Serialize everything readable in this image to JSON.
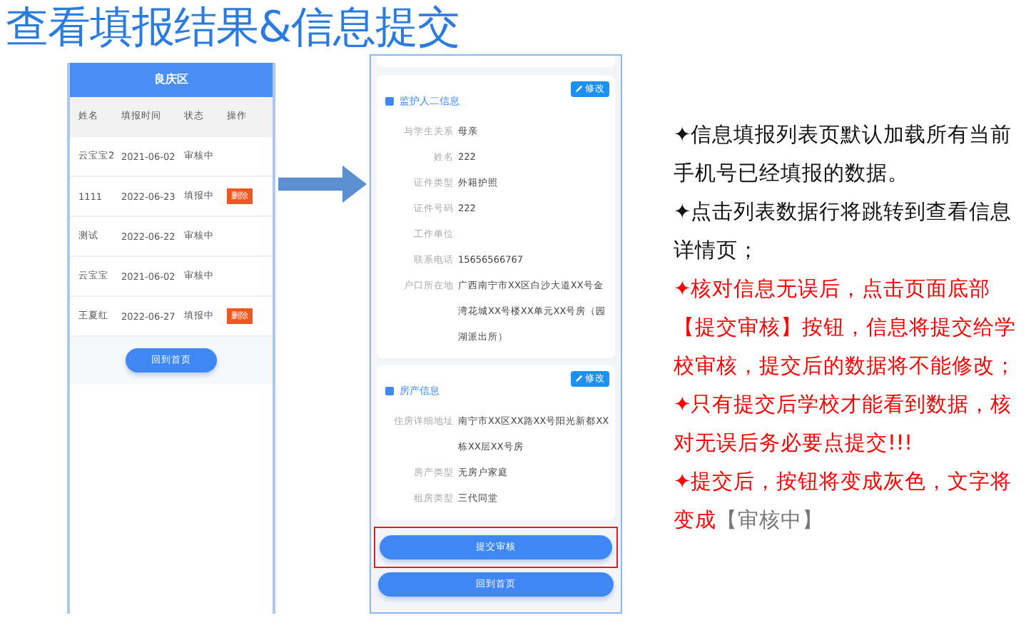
{
  "title": "查看填报结果&信息提交",
  "list_screen": {
    "header": "良庆区",
    "columns": [
      "姓名",
      "填报时间",
      "状态",
      "操作"
    ],
    "rows": [
      {
        "name": "云宝宝2",
        "date": "2021-06-02",
        "status": "审核中"
      },
      {
        "name": "1111",
        "date": "2022-06-23",
        "status": "填报中",
        "action": "删除"
      },
      {
        "name": "测试",
        "date": "2022-06-22",
        "status": "审核中"
      },
      {
        "name": "云宝宝",
        "date": "2021-06-02",
        "status": "审核中"
      },
      {
        "name": "王夏红",
        "date": "2022-06-27",
        "status": "填报中",
        "action": "删除"
      }
    ],
    "button": "回到首页"
  },
  "detail_screen": {
    "sections": [
      {
        "title": "监护人二信息",
        "edit": "修改",
        "fields": [
          {
            "label": "与学生关系",
            "value": "母亲"
          },
          {
            "label": "姓名",
            "value": "222"
          },
          {
            "label": "证件类型",
            "value": "外籍护照"
          },
          {
            "label": "证件号码",
            "value": "222"
          },
          {
            "label": "工作单位"
          },
          {
            "label": "联系电话",
            "value": "15656566767"
          },
          {
            "label": "户口所在地",
            "value": "广西南宁市XX区白沙大道XX号金湾花城XX号楼XX单元XX号房（园湖派出所）"
          }
        ]
      },
      {
        "title": "房产信息",
        "edit": "修改",
        "fields": [
          {
            "label": "住房详细地址",
            "value": "南宁市XX区XX路XX号阳光新都XX栋XX层XX号房"
          },
          {
            "label": "房产类型",
            "value": "无房户家庭"
          },
          {
            "label": "租房类型",
            "value": "三代同堂"
          }
        ]
      }
    ],
    "buttons": [
      {
        "label": "提交审核",
        "highlighted": true
      },
      {
        "label": "回到首页",
        "highlighted": false
      }
    ]
  },
  "notes": [
    {
      "parts": [
        {
          "text": "✦信息填报列表页默认加载所有当前手机号已经填报的数据。",
          "color": "#111111"
        }
      ]
    },
    {
      "parts": [
        {
          "text": "✦点击列表数据行将跳转到查看信息详情页；",
          "color": "#111111"
        }
      ]
    },
    {
      "parts": [
        {
          "text": "✦核对信息无误后，点击页面底部【提交审核】按钮，信息将提交给学校审核，提交后的数据将不能修改；",
          "color": "#ff0000"
        }
      ]
    },
    {
      "parts": [
        {
          "text": "✦只有提交后学校才能看到数据，核对无误后务必要点提交!!!",
          "color": "#ff0000"
        }
      ]
    },
    {
      "parts": [
        {
          "text": "✦提交后，按钮将变成灰色，文字将变成",
          "color": "#ff0000"
        },
        {
          "text": "【审核中】",
          "color": "#777777"
        }
      ]
    }
  ]
}
